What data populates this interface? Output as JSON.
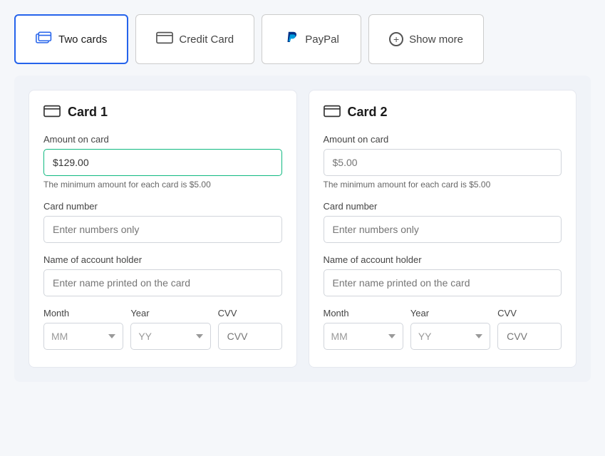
{
  "tabs": [
    {
      "id": "two-cards",
      "label": "Two cards",
      "active": true,
      "icon": "two-cards-icon"
    },
    {
      "id": "credit-card",
      "label": "Credit Card",
      "active": false,
      "icon": "credit-card-icon"
    },
    {
      "id": "paypal",
      "label": "PayPal",
      "active": false,
      "icon": "paypal-icon"
    },
    {
      "id": "show-more",
      "label": "Show more",
      "active": false,
      "icon": "plus-icon"
    }
  ],
  "card1": {
    "title": "Card 1",
    "amount_label": "Amount on card",
    "amount_value": "$129.00",
    "amount_hint": "The minimum amount for each card is $5.00",
    "card_number_label": "Card number",
    "card_number_placeholder": "Enter numbers only",
    "holder_label": "Name of account holder",
    "holder_placeholder": "Enter name printed on the card",
    "month_label": "Month",
    "month_placeholder": "MM",
    "year_label": "Year",
    "year_placeholder": "YY",
    "cvv_label": "CVV",
    "cvv_placeholder": "CVV"
  },
  "card2": {
    "title": "Card 2",
    "amount_label": "Amount on card",
    "amount_placeholder": "$5.00",
    "amount_hint": "The minimum amount for each card is $5.00",
    "card_number_label": "Card number",
    "card_number_placeholder": "Enter numbers only",
    "holder_label": "Name of account holder",
    "holder_placeholder": "Enter name printed on the card",
    "month_label": "Month",
    "month_placeholder": "MM",
    "year_label": "Year",
    "year_placeholder": "YY",
    "cvv_label": "CVV",
    "cvv_placeholder": "CVV"
  }
}
